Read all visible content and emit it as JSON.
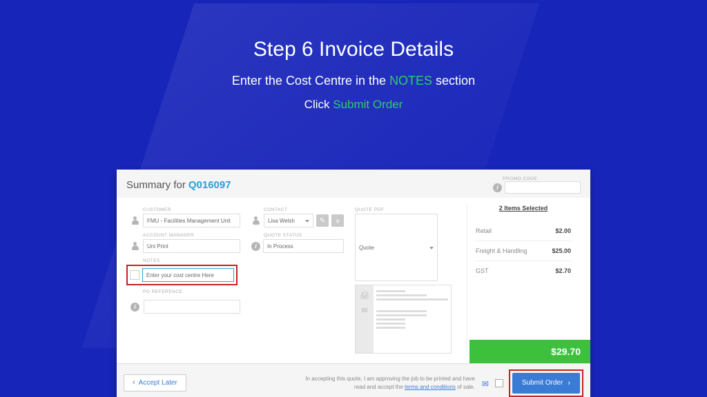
{
  "slide": {
    "title": "Step 6 Invoice Details",
    "sub_pre": "Enter the Cost Centre in the ",
    "sub_accent": "NOTES",
    "sub_post": " section",
    "sub2_pre": "Click ",
    "sub2_accent": "Submit Order"
  },
  "header": {
    "summary_label": "Summary for",
    "quote_id": "Q016097",
    "promo_label": "PROMO CODE"
  },
  "customer": {
    "label": "CUSTOMER",
    "value": "FMU - Facilities Management Unit"
  },
  "account_manager": {
    "label": "ACCOUNT MANAGER",
    "value": "Uni Print"
  },
  "notes": {
    "label": "NOTES",
    "value": "Enter your cost centre Here"
  },
  "po_reference": {
    "label": "PO REFERENCE"
  },
  "contact": {
    "label": "CONTACT",
    "value": "Lisa Welsh"
  },
  "quote_status": {
    "label": "QUOTE STATUS",
    "value": "In Process"
  },
  "quote_pdf": {
    "label": "QUOTE PDF",
    "value": "Quote"
  },
  "costs": {
    "items_selected": "2 Items Selected",
    "rows": [
      {
        "label": "Retail",
        "amount": "$2.00"
      },
      {
        "label": "Freight & Handling",
        "amount": "$25.00"
      },
      {
        "label": "GST",
        "amount": "$2.70"
      }
    ],
    "total": "$29.70"
  },
  "footer": {
    "accept_later": "Accept Later",
    "disclaimer_pre": "In accepting this quote, I am approving the job to be printed and have read and accept the ",
    "terms_link": "terms and conditions",
    "disclaimer_post": " of sale.",
    "submit": "Submit Order"
  }
}
